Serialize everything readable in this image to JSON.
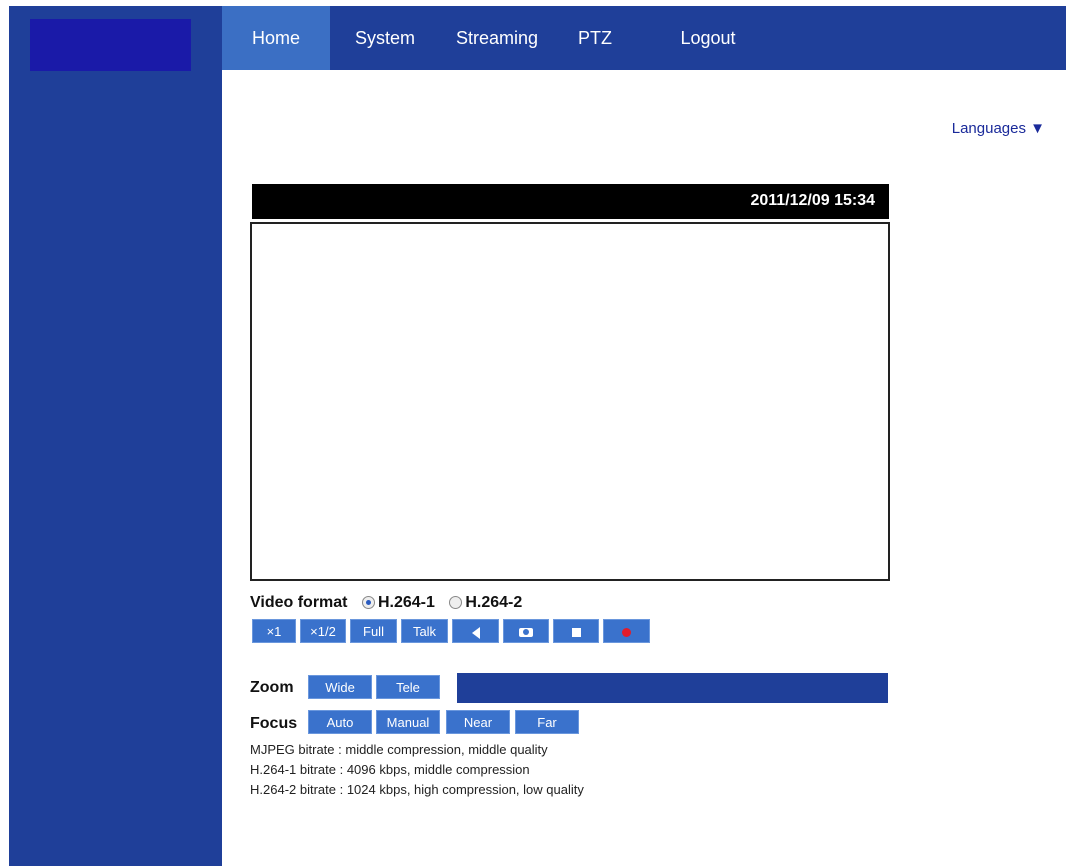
{
  "nav": {
    "items": [
      "Home",
      "System",
      "Streaming",
      "PTZ",
      "Logout"
    ],
    "active": "Home"
  },
  "languages_label": "Languages ▼",
  "video": {
    "timestamp": "2011/12/09 15:34"
  },
  "video_format": {
    "label": "Video format",
    "options": [
      "H.264-1",
      "H.264-2"
    ],
    "selected": "H.264-1"
  },
  "controls": {
    "x1": "×1",
    "x12": "×1/2",
    "full": "Full",
    "talk": "Talk",
    "icons": [
      "speaker-icon",
      "camera-icon",
      "stop-icon",
      "record-icon"
    ]
  },
  "zoom": {
    "label": "Zoom",
    "wide": "Wide",
    "tele": "Tele"
  },
  "focus": {
    "label": "Focus",
    "auto": "Auto",
    "manual": "Manual",
    "near": "Near",
    "far": "Far"
  },
  "info": [
    "MJPEG bitrate : middle compression, middle quality",
    "H.264-1 bitrate : 4096 kbps, middle compression",
    "H.264-2 bitrate : 1024 kbps, high compression, low quality"
  ],
  "colors": {
    "nav_bg": "#1f3f99",
    "nav_active": "#3b6fc4",
    "button": "#3a72cc",
    "record": "#e21c2a"
  }
}
